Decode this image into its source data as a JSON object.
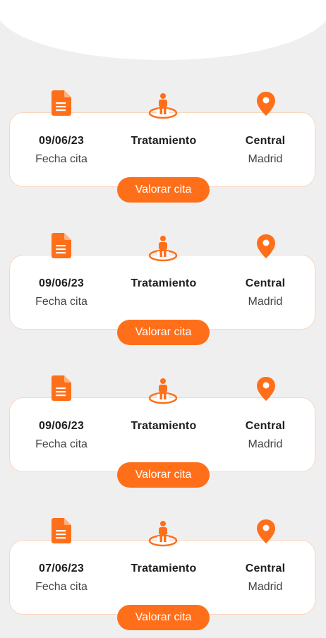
{
  "theme": {
    "accent": "#ff6f1a",
    "card_border": "#fbd6bf",
    "background": "#efefef"
  },
  "icons": {
    "date": "document-icon",
    "treatment": "person-icon",
    "location": "location-pin-icon"
  },
  "appointments": [
    {
      "date": "09/06/23",
      "date_label": "Fecha cita",
      "treatment": "Tratamiento",
      "center": "Central",
      "city": "Madrid",
      "button_label": "Valorar cita"
    },
    {
      "date": "09/06/23",
      "date_label": "Fecha cita",
      "treatment": "Tratamiento",
      "center": "Central",
      "city": "Madrid",
      "button_label": "Valorar cita"
    },
    {
      "date": "09/06/23",
      "date_label": "Fecha cita",
      "treatment": "Tratamiento",
      "center": "Central",
      "city": "Madrid",
      "button_label": "Valorar cita"
    },
    {
      "date": "07/06/23",
      "date_label": "Fecha cita",
      "treatment": "Tratamiento",
      "center": "Central",
      "city": "Madrid",
      "button_label": "Valorar cita"
    }
  ]
}
